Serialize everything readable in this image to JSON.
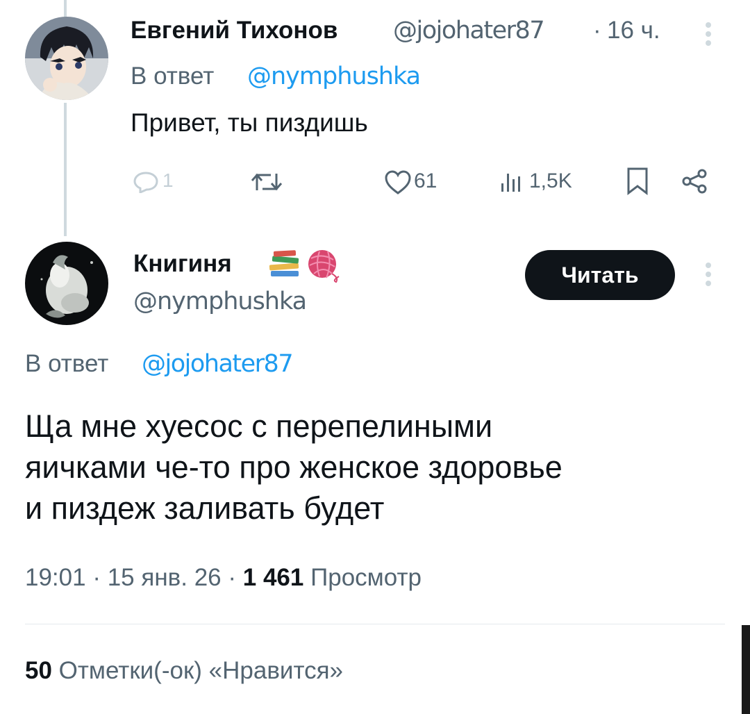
{
  "reply_tweet": {
    "author_name": "Евгений Тихонов",
    "handle": "@jojohater87",
    "separator": "·",
    "time": "16 ч.",
    "reply_prefix": "В ответ",
    "reply_to": "@nymphushka",
    "text": "Привет, ты пиздишь",
    "actions": {
      "replies": "1",
      "retweets": "",
      "likes": "61",
      "views": "1,5K"
    }
  },
  "main_tweet": {
    "author_name": "Книгиня",
    "name_emojis": "📚🧶",
    "handle": "@nymphushka",
    "follow_label": "Читать",
    "reply_prefix": "В ответ",
    "reply_to": "@jojohater87",
    "text_lines": [
      "Ща мне хуесос с перепелиными",
      "яичками че-то про женское здоровье",
      "и пиздеж заливать будет"
    ],
    "meta": {
      "time": "19:01",
      "sep1": "·",
      "date": "15 янв. 26",
      "sep2": "·",
      "views_count": "1 461",
      "views_label": "Просмотр"
    },
    "likes_row": {
      "count": "50",
      "label": "Отметки(-ок) «Нравится»"
    }
  },
  "colors": {
    "link": "#1d9bf0",
    "muted": "#536471",
    "text": "#0f1419",
    "thread_line": "#cfd9de"
  },
  "icons": [
    "reply-icon",
    "retweet-icon",
    "like-icon",
    "views-icon",
    "bookmark-icon",
    "share-icon",
    "more-icon"
  ]
}
